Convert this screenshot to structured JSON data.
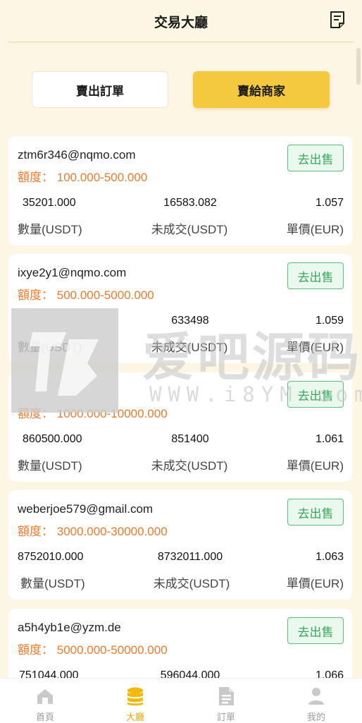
{
  "header": {
    "title": "交易大廳",
    "icon": "orders-note-icon"
  },
  "tabs": [
    {
      "label": "賣出訂單",
      "active": false
    },
    {
      "label": "賣給商家",
      "active": true
    }
  ],
  "quota_label": "額度：",
  "sell_button_label": "去出售",
  "column_labels": [
    "數量(USDT)",
    "未成交(USDT)",
    "單價(EUR)"
  ],
  "listings": [
    {
      "email": "ztm6r346@nqmo.com",
      "quota": "100.000-500.000",
      "quantity": "35201.000",
      "unfilled": "16583.082",
      "price": "1.057"
    },
    {
      "email": "ixye2y1@nqmo.com",
      "quota": "500.000-5000.000",
      "quantity": "",
      "unfilled": "633498",
      "price": "1.059"
    },
    {
      "email": "",
      "quota": "1000.000-10000.000",
      "quantity": "860500.000",
      "unfilled": "851400",
      "price": "1.061"
    },
    {
      "email": "weberjoe579@gmail.com",
      "quota": "3000.000-30000.000",
      "quantity": "8752010.000",
      "unfilled": "8732011.000",
      "price": "1.063"
    },
    {
      "email": "a5h4yb1e@yzm.de",
      "quota": "5000.000-50000.000",
      "quantity": "751044.000",
      "unfilled": "596044.000",
      "price": "1.066"
    }
  ],
  "watermark": {
    "text": "爱吧源码",
    "url": "WWW.i8YM.com"
  },
  "bottom_nav": [
    {
      "label": "首頁",
      "icon": "home-icon",
      "active": false
    },
    {
      "label": "大廳",
      "icon": "coin-stack-icon",
      "active": true
    },
    {
      "label": "訂單",
      "icon": "document-icon",
      "active": false
    },
    {
      "label": "我的",
      "icon": "user-icon",
      "active": false
    }
  ],
  "colors": {
    "accent": "#f5c93d",
    "quota": "#ee7a2c",
    "sell_green": "#3aa85c",
    "background": "#fdf6e4"
  }
}
